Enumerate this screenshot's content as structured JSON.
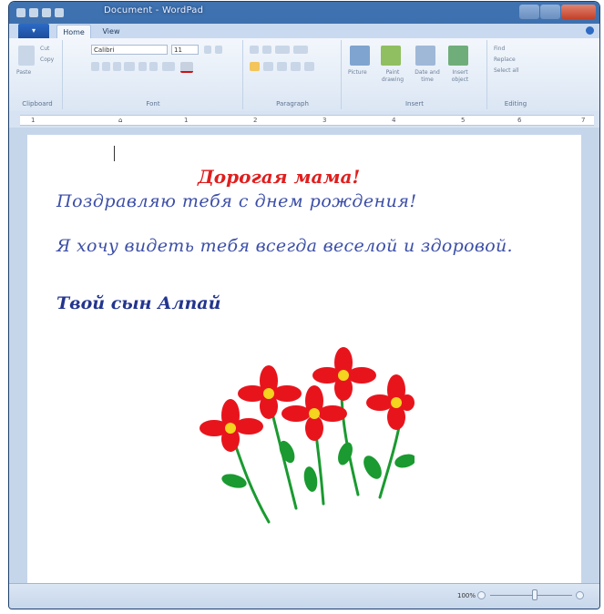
{
  "window": {
    "title": "Document - WordPad"
  },
  "tabs": {
    "file_label": "▾",
    "home": "Home",
    "view": "View"
  },
  "ribbon": {
    "clipboard": {
      "label": "Clipboard",
      "paste": "Paste",
      "cut": "Cut",
      "copy": "Copy"
    },
    "font": {
      "label": "Font",
      "font_name": "Calibri",
      "font_size": "11"
    },
    "paragraph": {
      "label": "Paragraph"
    },
    "insert": {
      "label": "Insert",
      "picture": "Picture",
      "paint_drawing": "Paint drawing",
      "date_time": "Date and time",
      "insert_object": "Insert object"
    },
    "editing": {
      "label": "Editing",
      "find": "Find",
      "replace": "Replace",
      "select_all": "Select all"
    }
  },
  "ruler": {
    "marks": [
      "1",
      "1",
      "2",
      "3",
      "4",
      "5",
      "6",
      "7"
    ]
  },
  "document": {
    "greeting": "Дорогая мама!",
    "line1": "Поздравляю тебя с днем рождения!",
    "line2": "Я хочу видеть тебя всегда веселой и здоровой.",
    "signature": "Твой сын Алпай"
  },
  "status": {
    "zoom": "100%"
  },
  "colors": {
    "petal": "#e8141c",
    "center": "#f4d41e",
    "stem": "#1a9a30",
    "leaf": "#1a9a30"
  }
}
